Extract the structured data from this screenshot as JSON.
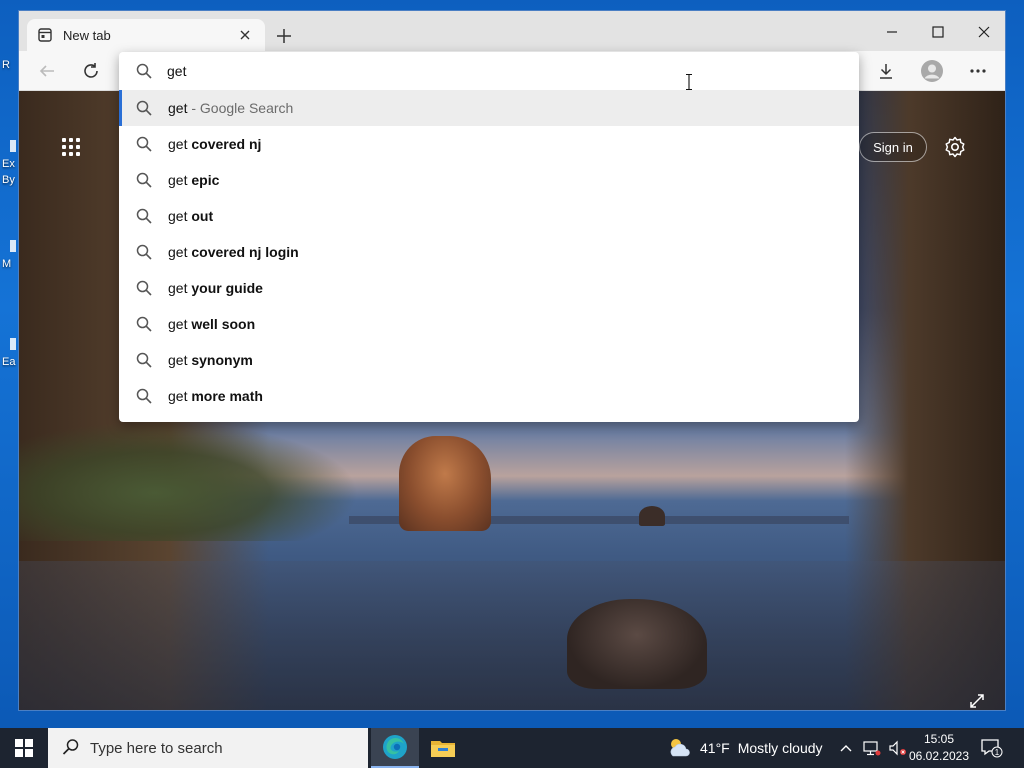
{
  "desktop": {
    "fragments": [
      "R",
      "Ex",
      "By",
      "M",
      "Ea"
    ]
  },
  "browser": {
    "tab": {
      "title": "New tab"
    },
    "address": {
      "value": "get"
    },
    "suggestions": [
      {
        "typed": "get",
        "completion": "",
        "hint": " - Google Search",
        "active": true
      },
      {
        "typed": "get",
        "completion": "covered nj",
        "hint": "",
        "active": false
      },
      {
        "typed": "get",
        "completion": "epic",
        "hint": "",
        "active": false
      },
      {
        "typed": "get",
        "completion": "out",
        "hint": "",
        "active": false
      },
      {
        "typed": "get",
        "completion": "covered nj login",
        "hint": "",
        "active": false
      },
      {
        "typed": "get",
        "completion": "your guide",
        "hint": "",
        "active": false
      },
      {
        "typed": "get",
        "completion": "well soon",
        "hint": "",
        "active": false
      },
      {
        "typed": "get",
        "completion": "synonym",
        "hint": "",
        "active": false
      },
      {
        "typed": "get",
        "completion": "more math",
        "hint": "",
        "active": false
      }
    ],
    "ntp": {
      "signin_label": "Sign in"
    },
    "colors": {
      "accent": "#2a6fd6"
    }
  },
  "taskbar": {
    "search_placeholder": "Type here to search",
    "weather_temp": "41°F",
    "weather_desc": "Mostly cloudy",
    "time": "15:05",
    "date": "06.02.2023",
    "notification_count": "1"
  }
}
